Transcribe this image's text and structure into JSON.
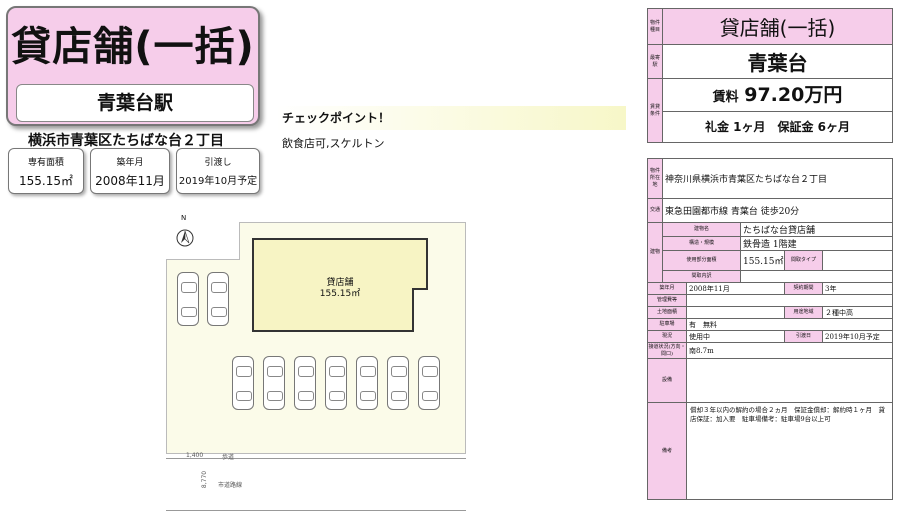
{
  "header": {
    "title": "貸店舗(一括)",
    "station": "青葉台駅",
    "address": "横浜市青葉区たちばな台２丁目"
  },
  "info_boxes": [
    {
      "label": "専有面積",
      "value": "155.15㎡"
    },
    {
      "label": "築年月",
      "value": "2008年11月"
    },
    {
      "label": "引渡し",
      "value": "2019年10月予定"
    }
  ],
  "checkpoint": {
    "title": "チェックポイント！",
    "body": "飲食店可,スケルトン"
  },
  "plan": {
    "building_label": "貸店舗",
    "building_area": "155.15㎡",
    "north": "N",
    "road1_width": "1,400",
    "road1_label": "歩道",
    "road2_width": "8,770",
    "road2_label": "市道路線"
  },
  "summary": {
    "type_label": "物件種目",
    "type": "貸店舗(一括)",
    "station_label": "最寄駅",
    "station": "青葉台",
    "terms_label": "賃貸条件",
    "rent_prefix": "賃料",
    "rent": "97.20万円",
    "deposit": "礼金 1ヶ月　保証金 6ヶ月"
  },
  "details": {
    "location_label": "物件所在地",
    "location": "神奈川県横浜市青葉区たちばな台２丁目",
    "transport_label": "交通",
    "transport": "東急田園都市線 青葉台 徒歩20分",
    "building_label": "建物",
    "name_label": "建物名",
    "name": "たちばな台貸店舗",
    "structure_label": "構造・規模",
    "structure": "鉄骨造 1階建",
    "area_label": "使用部分面積",
    "area": "155.15㎡",
    "layout_type_label": "間取タイプ",
    "layout_type": "",
    "layout_label": "間取内訳",
    "layout": "",
    "built_label": "築年月",
    "built": "2008年11月",
    "contract_label": "契約期間",
    "contract": "3年",
    "mgmt_label": "管理費等",
    "mgmt": "",
    "land_label": "土地面積",
    "land": "",
    "zoning_label": "用途地域",
    "zoning": "２種中高",
    "parking_label": "駐車場",
    "parking": "有　無料",
    "status_label": "現況",
    "status": "使用中",
    "handover_label": "引渡日",
    "handover": "2019年10月予定",
    "road_label": "接道状況(方向・間口)",
    "road": "南8.7m",
    "facilities_label": "設備",
    "facilities": "",
    "notes_label": "備考",
    "notes": "償却３年以内の解約の場合２ヵ月　保証金償却：解約時１ヶ月　貸店保証：加入要　駐車場備考：駐車場9台以上可"
  }
}
